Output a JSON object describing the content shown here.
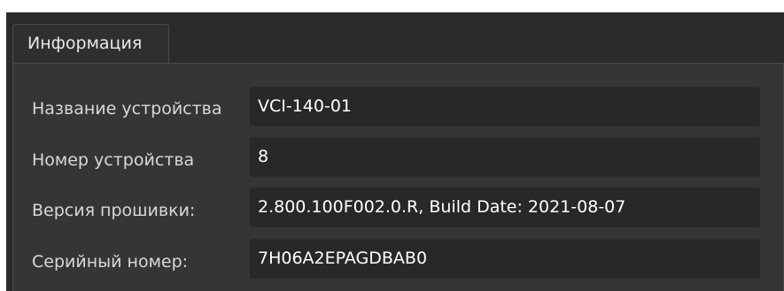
{
  "tab": {
    "label": "Информация"
  },
  "fields": [
    {
      "label": "Название устройства",
      "value": "VCI-140-01"
    },
    {
      "label": "Номер устройства",
      "value": "8"
    },
    {
      "label": "Версия прошивки:",
      "value": "2.800.100F002.0.R, Build Date: 2021-08-07"
    },
    {
      "label": "Серийный номер:",
      "value": "7H06A2EPAGDBAB0"
    }
  ],
  "colors": {
    "background": "#2b2b2b",
    "group_background": "#353535",
    "field_background": "#282828",
    "text": "#ffffff"
  }
}
